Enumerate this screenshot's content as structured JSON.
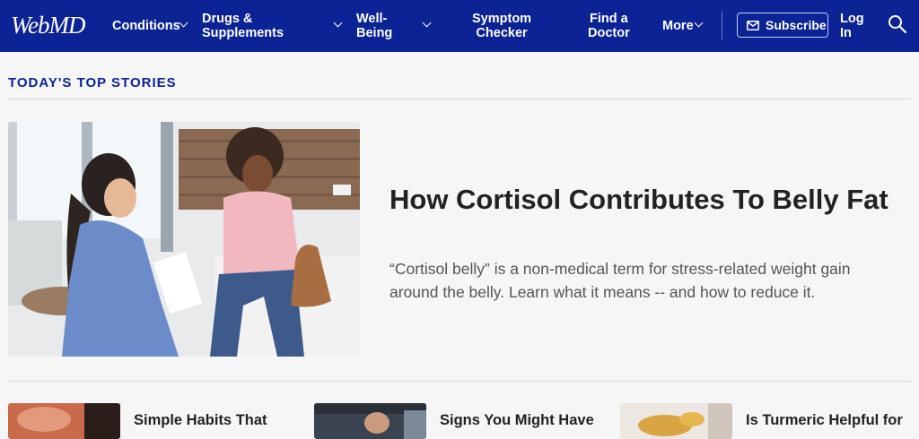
{
  "nav": {
    "logo": "WebMD",
    "items": [
      {
        "label": "Conditions"
      },
      {
        "label": "Drugs &\nSupplements"
      },
      {
        "label": "Well-\nBeing"
      },
      {
        "label": "Symptom\nChecker"
      },
      {
        "label": "Find a\nDoctor"
      },
      {
        "label": "More"
      }
    ],
    "subscribe": "Subscribe",
    "login": "Log\nIn",
    "icons": [
      "chevron-down-icon",
      "mail-icon",
      "search-icon"
    ]
  },
  "section": {
    "title": "TODAY'S TOP STORIES"
  },
  "feature": {
    "headline": "How Cortisol Contributes To Belly Fat",
    "summary": "“Cortisol belly” is a non-medical term for stress-related weight gain around the belly. Learn what it means -- and how to reduce it."
  },
  "stories": [
    {
      "title": "Simple Habits That"
    },
    {
      "title": "Signs You Might Have"
    },
    {
      "title": "Is Turmeric Helpful for"
    }
  ],
  "colors": {
    "nav_bg": "#0b2394",
    "page_bg": "#f6f6f6",
    "section_title": "#0b2394"
  }
}
